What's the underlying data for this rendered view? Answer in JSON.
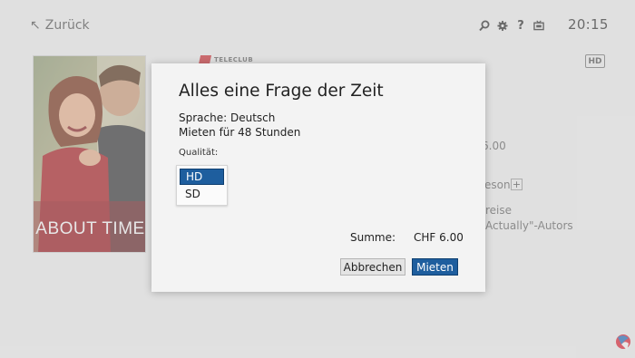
{
  "header": {
    "back_label": "Zurück",
    "icons": [
      "search-icon",
      "settings-icon",
      "help-icon",
      "recordings-icon"
    ],
    "clock": "20:15"
  },
  "movie": {
    "poster_title": "ABOUT TIME",
    "channel_logo_text": "TELECLUB",
    "format_badge": "HD",
    "partial_texts": {
      "price": "6.00",
      "season": "eson",
      "line1": "reise",
      "line2": "Actually\"-Autors"
    }
  },
  "dialog": {
    "title": "Alles eine Frage der Zeit",
    "language": "Sprache: Deutsch",
    "rental_period": "Mieten für 48 Stunden",
    "quality_label": "Qualität:",
    "quality_options": [
      {
        "label": "HD",
        "selected": true
      },
      {
        "label": "SD",
        "selected": false
      }
    ],
    "sum_label": "Summe:",
    "sum_value": "CHF 6.00",
    "cancel_label": "Abbrechen",
    "rent_label": "Mieten"
  },
  "colors": {
    "accent": "#1e5e9e",
    "background": "#e9e9e9",
    "dialog_bg": "#f3f3f3",
    "channel_red": "#c8353b"
  }
}
